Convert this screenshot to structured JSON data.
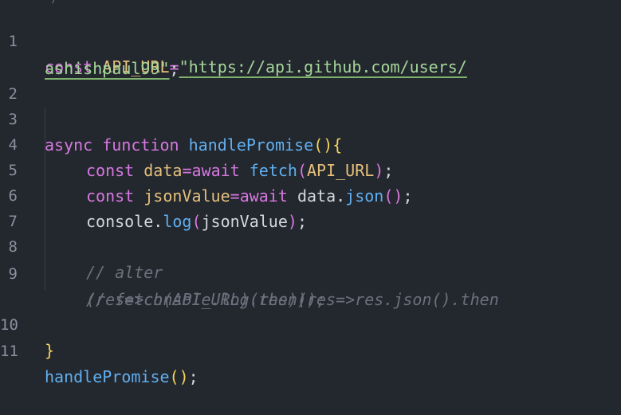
{
  "line_numbers": [
    "1",
    "2",
    "3",
    "4",
    "5",
    "6",
    "7",
    "8",
    "9",
    "10",
    "11"
  ],
  "lines": {
    "l1": {
      "kw": "const",
      "var": "API_URL",
      "op": "=",
      "q1": "\"",
      "url": "https://api.github.com/users/"
    },
    "l1b": {
      "url": "ashishpaul99",
      "q2": "\"",
      "semi": ";"
    },
    "l3": {
      "kw1": "async",
      "kw2": "function",
      "fn": "handlePromise",
      "p1": "(",
      "p2": ")",
      "brace": "{"
    },
    "l4": {
      "kw": "const",
      "var": "data",
      "op": "=",
      "kw2": "await",
      "fn": "fetch",
      "p1": "(",
      "arg": "API_URL",
      "p2": ")",
      "semi": ";"
    },
    "l5": {
      "kw": "const",
      "var": "jsonValue",
      "op": "=",
      "kw2": "await",
      "obj": "data",
      "dot": ".",
      "fn": "json",
      "p": "()",
      "semi": ";"
    },
    "l6": {
      "obj": "console",
      "dot": ".",
      "fn": "log",
      "p1": "(",
      "arg": "jsonValue",
      "p2": ")",
      "semi": ";"
    },
    "l8": {
      "comment": "// alter"
    },
    "l9": {
      "comment": "// fetch(API_URL).then(res=>res.json().then"
    },
    "l9b": {
      "comment": "(res=>console.log(res)));"
    },
    "l10": {
      "brace": "}"
    },
    "l11": {
      "fn": "handlePromise",
      "p": "()",
      "semi": ";"
    }
  },
  "colors": {
    "background": "#23272e",
    "keyword": "#d778e0",
    "function": "#61afef",
    "variable": "#e5c07b",
    "string": "#a5d69a",
    "comment": "#6b717d"
  }
}
